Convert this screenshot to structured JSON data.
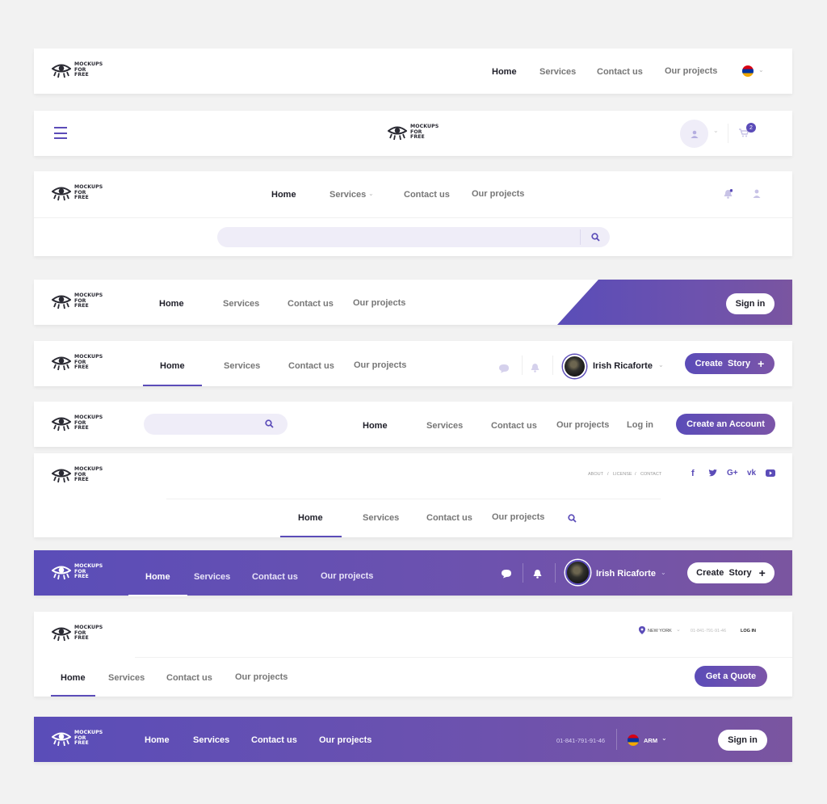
{
  "brand": {
    "logo_text": "MOCKUPS\nFOR\nFREE"
  },
  "colors": {
    "accent": "#5b4cb8",
    "accent_end": "#7b55a8",
    "background": "#f2f2f2"
  },
  "nav": {
    "home": "Home",
    "services": "Services",
    "contact": "Contact us",
    "projects": "Our projects"
  },
  "user": {
    "name": "Irish Ricaforte"
  },
  "cart": {
    "count": "2"
  },
  "buttons": {
    "sign_in": "Sign in",
    "create_story": "Create  Story",
    "create_account": "Create an Account",
    "log_in": "Log in",
    "get_quote": "Get a Quote"
  },
  "top_links": {
    "about": "ABOUT",
    "license": "LICENSE",
    "contact": "CONTACT",
    "sep": "/"
  },
  "location": {
    "city": "NEW YORK",
    "phone": "01-841-791-91-46",
    "login": "LOG IN"
  },
  "footer_bar": {
    "phone": "01-841-791-91-46",
    "lang": "ARM"
  },
  "icons": [
    "eye-logo-icon",
    "flag-armenia-icon",
    "chevron-down-icon",
    "hamburger-icon",
    "user-icon",
    "cart-icon",
    "bell-icon",
    "search-icon",
    "chat-icon",
    "plus-icon",
    "facebook-icon",
    "twitter-icon",
    "google-plus-icon",
    "vk-icon",
    "youtube-icon",
    "map-pin-icon"
  ]
}
